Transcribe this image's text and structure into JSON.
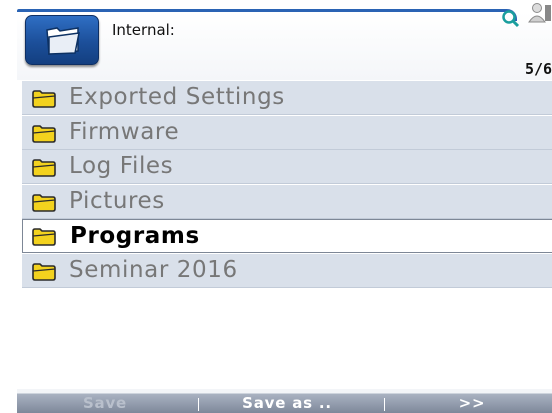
{
  "header": {
    "storage_label": "Internal:",
    "page_count": "5/6"
  },
  "icons": {
    "storage_button": "folder-icon",
    "search": "search-icon",
    "user": "user-icon",
    "row_folder": "folder-icon"
  },
  "folders": [
    {
      "label": "Exported Settings",
      "selected": false
    },
    {
      "label": "Firmware",
      "selected": false
    },
    {
      "label": "Log Files",
      "selected": false
    },
    {
      "label": "Pictures",
      "selected": false
    },
    {
      "label": "Programs",
      "selected": true
    },
    {
      "label": "Seminar 2016",
      "selected": false
    }
  ],
  "toolbar": {
    "save_label": "Save",
    "save_enabled": false,
    "save_as_label": "Save as ..",
    "next_label": ">>"
  },
  "colors": {
    "accent": "#2a63b4",
    "row_bg": "#d9e0ea",
    "folder_yellow": "#f3d21e",
    "toolbar_bg": "#8e98a8"
  }
}
